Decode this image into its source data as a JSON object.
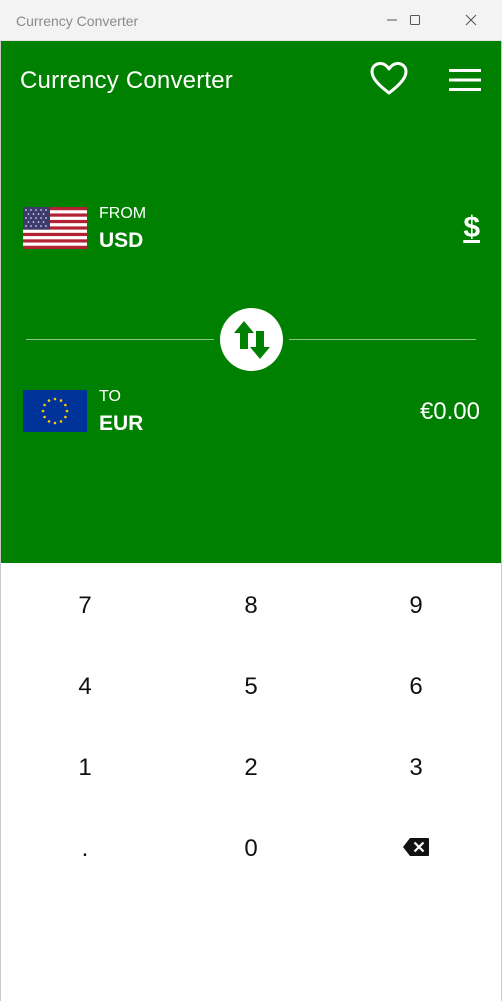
{
  "window": {
    "title": "Currency Converter"
  },
  "header": {
    "title": "Currency Converter",
    "favorite_icon": "heart-outline-icon",
    "menu_icon": "hamburger-menu-icon"
  },
  "from": {
    "label": "FROM",
    "code": "USD",
    "symbol": "$",
    "flag": "us-flag"
  },
  "to": {
    "label": "TO",
    "code": "EUR",
    "amount": "€0.00",
    "flag": "eu-flag"
  },
  "swap": {
    "icon": "swap-arrows-icon"
  },
  "keypad": {
    "keys": [
      "7",
      "8",
      "9",
      "4",
      "5",
      "6",
      "1",
      "2",
      "3",
      ".",
      "0"
    ],
    "backspace_icon": "backspace-icon"
  },
  "colors": {
    "accent": "#008000",
    "text_on_accent": "#ffffff",
    "titlebar": "#f3f3f3"
  }
}
